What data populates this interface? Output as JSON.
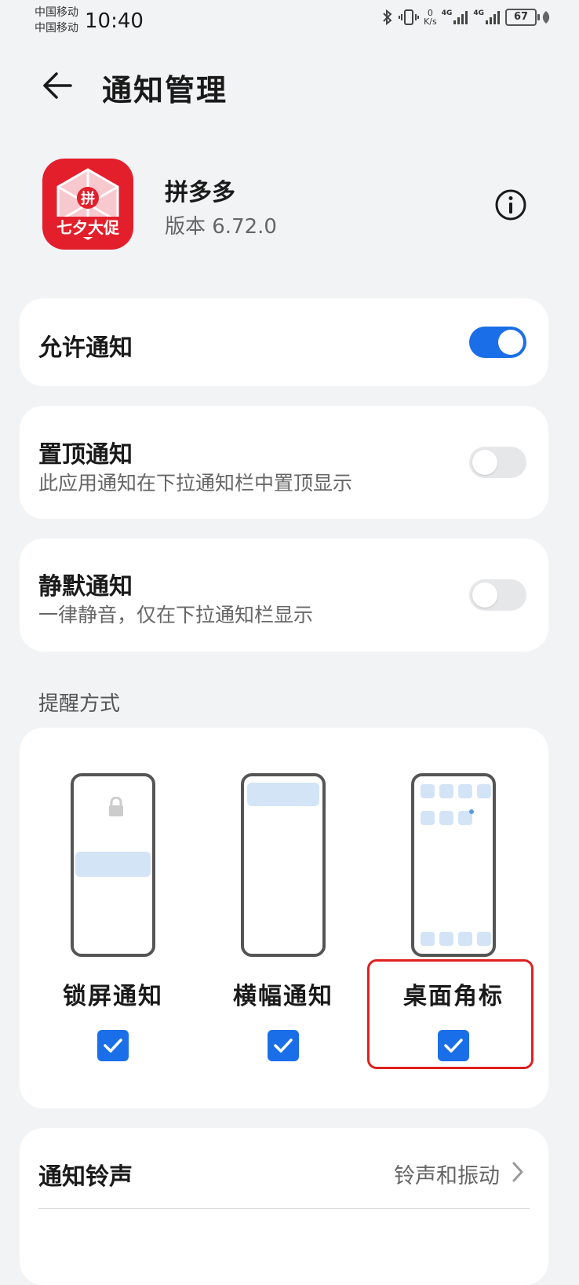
{
  "status_bar": {
    "carrier_1": "中国移动",
    "carrier_2": "中国移动",
    "time": "10:40",
    "speed_value": "0",
    "speed_unit": "K/s",
    "network_1": "4G",
    "network_2": "4G",
    "battery": "67"
  },
  "header": {
    "title": "通知管理"
  },
  "app": {
    "name": "拼多多",
    "version": "版本 6.72.0",
    "icon_center_text": "拼",
    "icon_banner_text": "七夕大促",
    "icon_colors": {
      "primary": "#e31f2b",
      "secondary": "#ffffff"
    }
  },
  "settings": {
    "allow_notifications": {
      "label": "允许通知",
      "enabled": true
    },
    "pinned": {
      "label": "置顶通知",
      "description": "此应用通知在下拉通知栏中置顶显示",
      "enabled": false
    },
    "silent": {
      "label": "静默通知",
      "description": "一律静音，仅在下拉通知栏显示",
      "enabled": false
    }
  },
  "reminder": {
    "section_label": "提醒方式",
    "options": [
      {
        "label": "锁屏通知",
        "checked": true,
        "icon": "lockscreen-illustration"
      },
      {
        "label": "横幅通知",
        "checked": true,
        "icon": "banner-illustration"
      },
      {
        "label": "桌面角标",
        "checked": true,
        "icon": "badge-illustration"
      }
    ]
  },
  "ringtone": {
    "label": "通知铃声",
    "value": "铃声和振动"
  },
  "colors": {
    "accent": "#1a6fe8",
    "background": "#f1f3f5",
    "highlight": "#e0201e"
  }
}
